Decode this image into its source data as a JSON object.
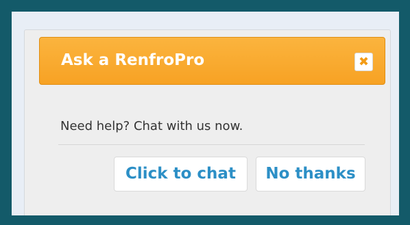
{
  "dialog": {
    "title": "Ask a RenfroPro",
    "close_icon": "close-icon",
    "close_glyph": "✖",
    "message": "Need help? Chat with us now.",
    "chat_button_label": "Click to chat",
    "decline_button_label": "No thanks"
  },
  "colors": {
    "page_background": "#135a69",
    "header_orange": "#f7a224",
    "button_text_blue": "#2c8fc6"
  }
}
